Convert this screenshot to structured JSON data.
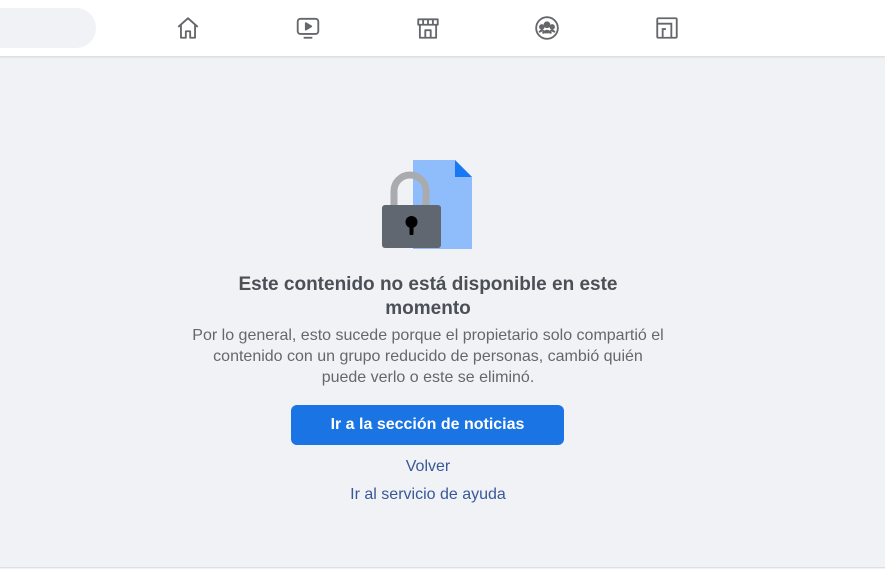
{
  "topbar": {
    "nav": [
      {
        "name": "home",
        "icon": "home-icon"
      },
      {
        "name": "video",
        "icon": "video-play-icon"
      },
      {
        "name": "marketplace",
        "icon": "marketplace-store-icon"
      },
      {
        "name": "groups",
        "icon": "groups-icon"
      },
      {
        "name": "gaming",
        "icon": "gaming-icon"
      }
    ]
  },
  "main": {
    "illustration": "locked-document-icon",
    "title": "Este contenido no está disponible en este momento",
    "description": "Por lo general, esto sucede porque el propietario solo compartió el contenido con un grupo reducido de personas, cambió quién puede verlo o este se eliminó.",
    "primary_button": "Ir a la sección de noticias",
    "back_link": "Volver",
    "help_link": "Ir al servicio de ayuda"
  },
  "colors": {
    "accent": "#1b74e4",
    "link": "#385898",
    "background": "#f0f2f5",
    "document": "#8fbcfb",
    "lock": "#606770"
  }
}
